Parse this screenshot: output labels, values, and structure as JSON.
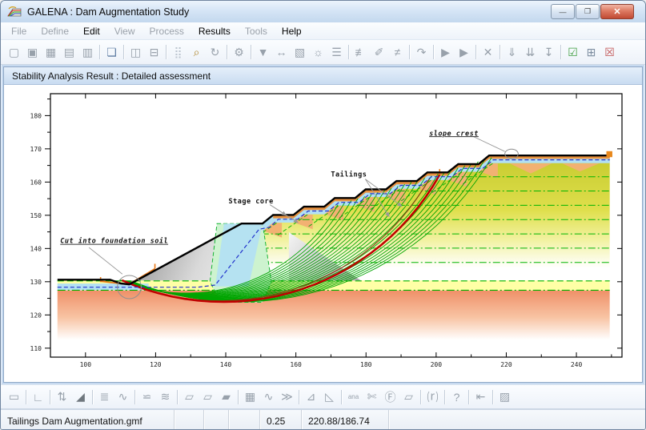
{
  "window": {
    "title": "GALENA : Dam Augmentation Study",
    "buttons": {
      "minimize": "—",
      "restore": "❐",
      "close": "✕"
    }
  },
  "menu": {
    "items": [
      {
        "label": "File",
        "enabled": false
      },
      {
        "label": "Define",
        "enabled": false
      },
      {
        "label": "Edit",
        "enabled": true
      },
      {
        "label": "View",
        "enabled": false
      },
      {
        "label": "Process",
        "enabled": false
      },
      {
        "label": "Results",
        "enabled": true
      },
      {
        "label": "Tools",
        "enabled": false
      },
      {
        "label": "Help",
        "enabled": true
      }
    ]
  },
  "toolbar_top": {
    "items": [
      {
        "n": "new-file",
        "g": "▢"
      },
      {
        "n": "open-file",
        "g": "▣"
      },
      {
        "n": "save-file",
        "g": "▦"
      },
      {
        "n": "save-as",
        "g": "▤"
      },
      {
        "n": "close-file",
        "g": "▥"
      },
      "|",
      {
        "n": "copy",
        "g": "❏",
        "c": "#5f7da3"
      },
      "|",
      {
        "n": "print-preview",
        "g": "◫"
      },
      {
        "n": "print",
        "g": "⊟"
      },
      "|",
      {
        "n": "grid",
        "g": "⣿",
        "c": "#bcc5cf"
      },
      {
        "n": "zoom",
        "g": "⌕",
        "c": "#b08830"
      },
      {
        "n": "refresh",
        "g": "↻"
      },
      "|",
      {
        "n": "settings",
        "g": "⚙"
      },
      "|",
      {
        "n": "filter",
        "g": "▼"
      },
      {
        "n": "extents",
        "g": "↔"
      },
      {
        "n": "image-export",
        "g": "▧"
      },
      {
        "n": "ideas",
        "g": "☼"
      },
      {
        "n": "tree-view",
        "g": "☰"
      },
      "|",
      {
        "n": "edit-material",
        "g": "≢"
      },
      {
        "n": "edit-profile",
        "g": "✐"
      },
      {
        "n": "edit-restraints",
        "g": "≠"
      },
      "|",
      {
        "n": "reprocess",
        "g": "↷"
      },
      "|",
      {
        "n": "run-analysis",
        "g": "▶"
      },
      {
        "n": "run-new",
        "g": "▶"
      },
      "|",
      {
        "n": "cancel",
        "g": "✕"
      },
      "|",
      {
        "n": "sort-list",
        "g": "⇓"
      },
      {
        "n": "sort-down",
        "g": "⇊"
      },
      {
        "n": "sort-to-end",
        "g": "↧"
      },
      "|",
      {
        "n": "results-ok",
        "g": "☑",
        "c": "#3f9d3f"
      },
      {
        "n": "results-table",
        "g": "⊞",
        "c": "#7d8da0"
      },
      {
        "n": "results-error",
        "g": "☒",
        "c": "#c05050"
      }
    ]
  },
  "child_window": {
    "title": "Stability Analysis Result : Detailed assessment"
  },
  "toolbar_bottom": {
    "items": [
      {
        "n": "page-frame",
        "g": "▭"
      },
      "|",
      {
        "n": "axes",
        "g": "∟"
      },
      "|",
      {
        "n": "profile-flip",
        "g": "⇅"
      },
      {
        "n": "slope-surface",
        "g": "◢",
        "c": "#6f777e"
      },
      "|",
      {
        "n": "material-layers",
        "g": "≣"
      },
      {
        "n": "profile-curve",
        "g": "∿"
      },
      "|",
      {
        "n": "phreatic-surface",
        "g": "⋍"
      },
      {
        "n": "piezo-surface",
        "g": "≋"
      },
      "|",
      {
        "n": "region-a",
        "g": "▱"
      },
      {
        "n": "region-b",
        "g": "▱"
      },
      {
        "n": "region-lock",
        "g": "▰"
      },
      "|",
      {
        "n": "distributed-load",
        "g": "▦"
      },
      {
        "n": "seismic-load",
        "g": "∿"
      },
      {
        "n": "point-load",
        "g": "≫"
      },
      "|",
      {
        "n": "slip-circular",
        "g": "⊿"
      },
      {
        "n": "slip-block",
        "g": "◺"
      },
      "|",
      {
        "n": "analysis-annotate",
        "g": "ana",
        "t": 1
      },
      {
        "n": "section-cut",
        "g": "✄"
      },
      {
        "n": "factor-box",
        "g": "Ⓕ"
      },
      {
        "n": "slip-search",
        "g": "▱"
      },
      "|",
      {
        "n": "restart-marker",
        "g": "⒭"
      },
      "|",
      {
        "n": "query-region",
        "g": "?"
      },
      "|",
      {
        "n": "back-calculate",
        "g": "⇤"
      },
      "|",
      {
        "n": "hatch-query",
        "g": "▨"
      }
    ]
  },
  "statusbar": {
    "cells": [
      "Tailings Dam Augmentation.gmf",
      "",
      "",
      "",
      "0.25",
      "220.88/186.74",
      ""
    ]
  },
  "chart_data": {
    "type": "diagram",
    "description": "Slope stability cross-section of tailings dam augmentation with trial slip circles",
    "x_axis": {
      "min": 90,
      "max": 253,
      "major_ticks": [
        100,
        120,
        140,
        160,
        180,
        200,
        220,
        240
      ],
      "minor_step": 10
    },
    "y_axis": {
      "min": 107.3,
      "max": 186.6,
      "major_ticks": [
        110,
        120,
        130,
        140,
        150,
        160,
        170,
        180
      ],
      "minor_step": 5
    },
    "surface_profile": [
      [
        92,
        130.6
      ],
      [
        107,
        130.6
      ],
      [
        110,
        129.5
      ],
      [
        112.5,
        129.2
      ],
      [
        144.5,
        147.5
      ],
      [
        150.5,
        147.5
      ],
      [
        153.5,
        150.1
      ],
      [
        159.3,
        150.1
      ],
      [
        162.3,
        152.6
      ],
      [
        168.1,
        152.6
      ],
      [
        171.1,
        155.2
      ],
      [
        176.9,
        155.2
      ],
      [
        179.9,
        157.8
      ],
      [
        185.7,
        157.8
      ],
      [
        188.7,
        160.3
      ],
      [
        194.5,
        160.3
      ],
      [
        197.5,
        162.9
      ],
      [
        203.3,
        162.9
      ],
      [
        206.3,
        165.4
      ],
      [
        212.1,
        165.4
      ],
      [
        215.1,
        168
      ],
      [
        249.5,
        168
      ]
    ],
    "phreatic_line": [
      [
        92,
        128.35
      ],
      [
        132,
        128.35
      ],
      [
        137,
        129
      ],
      [
        149.5,
        145.8
      ],
      [
        152.5,
        146.4
      ],
      [
        155,
        148.8
      ],
      [
        160.5,
        148.8
      ],
      [
        163.5,
        151.3
      ],
      [
        169.3,
        151.3
      ],
      [
        172.3,
        153.9
      ],
      [
        178.1,
        153.9
      ],
      [
        181.1,
        156.5
      ],
      [
        186.9,
        156.5
      ],
      [
        189.9,
        159
      ],
      [
        195.7,
        159
      ],
      [
        198.7,
        161.6
      ],
      [
        204.5,
        161.6
      ],
      [
        207.5,
        164.1
      ],
      [
        213.3,
        164.1
      ],
      [
        216.3,
        166.7
      ],
      [
        249.5,
        166.7
      ]
    ],
    "regions": {
      "basal_yellow_band": {
        "x": [
          92,
          249.5
        ],
        "top": 130.4,
        "bottom": 127.35,
        "color": "#ffffa6"
      },
      "left_water_band": {
        "x": [
          92,
          118
        ],
        "top": 129.45,
        "bottom": 127.45,
        "color": "#b2e0f4"
      },
      "foundation": {
        "x": [
          92,
          249.5
        ],
        "top": 127.35,
        "fade_to": 112.5,
        "color": "#ef9068"
      },
      "original_dam": {
        "points": [
          [
            112.5,
            129.2
          ],
          [
            144.5,
            147.5
          ],
          [
            150.5,
            147.5
          ],
          [
            165.8,
            130.4
          ],
          [
            113,
            130.4
          ]
        ]
      },
      "stage2_shell": {
        "points": [
          [
            158,
            144.9
          ],
          [
            178.5,
            130.4
          ],
          [
            158,
            130.4
          ]
        ]
      },
      "core": {
        "points": [
          [
            137.5,
            147.5
          ],
          [
            150.5,
            147.5
          ],
          [
            153,
            130
          ],
          [
            150.5,
            123.8
          ],
          [
            138.5,
            123.8
          ],
          [
            135.5,
            130
          ]
        ],
        "color": "#cdf3cf",
        "border": "#17b435"
      },
      "core_water": {
        "points": [
          [
            139.5,
            147.5
          ],
          [
            150.5,
            147.5
          ],
          [
            146.5,
            128.6
          ],
          [
            137,
            128.6
          ]
        ],
        "color": "#b2e0f4"
      },
      "tailings": {
        "color_top": "#c6ca2e",
        "color_mid": "#dfdf4c",
        "bottom": 131.5
      },
      "face_water_depth": 2.3,
      "face_cap_depth": 1.0,
      "face_cap_color": "#e8913f",
      "tan_wedge_color": "#f2b172",
      "crest_wedges": [
        [
          [
            221,
            165.6
          ],
          [
            233,
            165.6
          ],
          [
            227,
            162.6
          ]
        ],
        [
          [
            236,
            165.6
          ],
          [
            246.5,
            165.6
          ],
          [
            241,
            163.2
          ]
        ]
      ]
    },
    "hatch": {
      "color": "#00b400",
      "horizontal_elevs": [
        135.8,
        140.1,
        144.4,
        148.7,
        153,
        157.3,
        161.6,
        165.9
      ],
      "band_lines": [
        {
          "elev": 130.25,
          "dash": "8,4"
        },
        {
          "elev": 127.45,
          "dash": "10,3,2,3"
        }
      ]
    },
    "slip_surfaces": {
      "count": 24,
      "color": "#00a400",
      "exit_from": [
        109.6,
        130.55
      ],
      "exit_to": [
        113.8,
        129.9
      ],
      "entry_from": [
        172,
        153.2
      ],
      "entry_to": [
        215.8,
        167.4
      ],
      "low_from": [
        138,
        127.5
      ],
      "low_to": [
        162,
        126.0
      ],
      "critical": {
        "color": "#c00000",
        "entry": [
          201,
          162.2
        ],
        "low": [
          157,
          126.3
        ],
        "exit": [
          110.4,
          130.45
        ]
      },
      "secondary": {
        "color": "#8a3c12",
        "entry": [
          198.2,
          161.3
        ],
        "low": [
          155.3,
          126.5
        ],
        "exit": [
          110.8,
          130.35
        ]
      },
      "toe_surface": {
        "color": "#e87818",
        "points": [
          [
            104.3,
            130.15
          ],
          [
            112.3,
            129.15
          ],
          [
            119.8,
            133.9
          ]
        ],
        "ticks": [
          [
            [
              104.3,
              129.9
            ],
            [
              104.3,
              131.4
            ]
          ],
          [
            [
              119.8,
              133.9
            ],
            [
              119.8,
              135.4
            ]
          ],
          [
            [
              201,
              162.2
            ],
            [
              201,
              163.9
            ]
          ]
        ]
      }
    },
    "annotations": [
      {
        "text": "Cut into foundation soil",
        "at": [
          92.8,
          141.6
        ],
        "italic": true,
        "underline": true,
        "arrow": false,
        "leaders": [
          [
            [
              101,
              140.3
            ],
            [
              110.5,
              132.3
            ]
          ]
        ]
      },
      {
        "text": "Stage core",
        "at": [
          140.8,
          153.6
        ],
        "italic": false,
        "underline": false,
        "arrow": true,
        "leaders": [
          [
            [
              152.6,
              153.2
            ],
            [
              157.2,
              150
            ]
          ],
          [
            [
              152.6,
              153.2
            ],
            [
              160.6,
              147.8
            ]
          ]
        ]
      },
      {
        "text": "Tailings",
        "at": [
          170,
          161.6
        ],
        "italic": false,
        "underline": false,
        "arrow": true,
        "leaders": [
          [
            [
              179.8,
              160.9
            ],
            [
              186.6,
              149.6
            ]
          ],
          [
            [
              179.8,
              160.9
            ],
            [
              190.2,
              152.7
            ]
          ]
        ]
      },
      {
        "text": "slope crest",
        "at": [
          198,
          174
        ],
        "italic": true,
        "underline": true,
        "arrow": false,
        "leaders": [
          [
            [
              210.6,
              173.7
            ],
            [
              219.6,
              169.2
            ]
          ]
        ]
      }
    ],
    "markers": {
      "toe_ellipse": {
        "c": [
          112.5,
          128.4
        ],
        "r": [
          3.4,
          3.5
        ]
      },
      "crest_circle": {
        "c": [
          221.5,
          168.5
        ],
        "r": [
          1.9,
          1.4
        ]
      },
      "crest_end_square": {
        "c": [
          249.4,
          168.4
        ],
        "size": 1.7,
        "color": "#e8881c"
      }
    }
  }
}
